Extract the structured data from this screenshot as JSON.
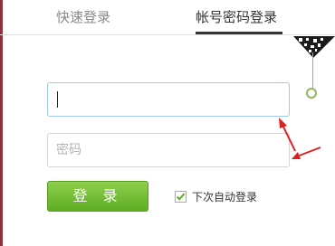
{
  "tabs": {
    "quick_login": "快速登录",
    "account_password_login": "帐号密码登录"
  },
  "form": {
    "account_value": "",
    "password_placeholder": "密码",
    "login_button": "登 录",
    "remember_label": "下次自动登录",
    "remember_checked": true
  },
  "icons": {
    "qr": "qr-code-corner-icon",
    "checkmark": "checkmark-icon",
    "annotation": "red-arrow-icon"
  },
  "colors": {
    "login_button": "#6dbb30",
    "active_tab": "#333333",
    "focus_border": "#9ec9f0",
    "annotation": "#e02020",
    "qr_line": "#8fb85c"
  }
}
